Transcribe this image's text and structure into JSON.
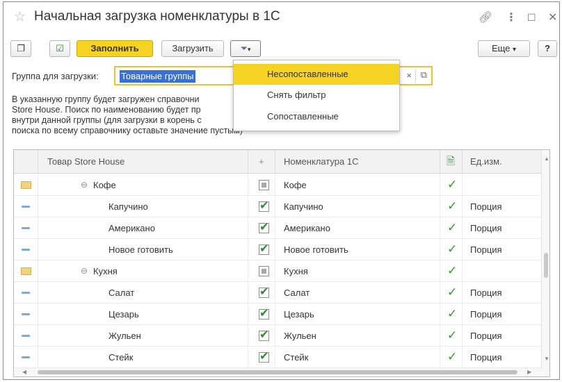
{
  "window": {
    "title": "Начальная загрузка номенклатуры в 1С"
  },
  "toolbar": {
    "fill_label": "Заполнить",
    "load_label": "Загрузить",
    "more_label": "Еще",
    "help_label": "?"
  },
  "group": {
    "label": "Группа для загрузки:",
    "value": "Товарные группы"
  },
  "note": {
    "line1": "В указанную группу будет загружен справочни",
    "line2": "Store House. Поиск по наименованию будет пр",
    "line3": "внутри данной группы (для загрузки в корень с",
    "line4": "поиска по всему справочнику оставьте значение пустым)"
  },
  "filter_menu": {
    "items": [
      {
        "label": "Несопоставленные",
        "active": true
      },
      {
        "label": "Снять фильтр",
        "active": false
      },
      {
        "label": "Сопоставленные",
        "active": false
      }
    ]
  },
  "table": {
    "headers": {
      "product": "Товар Store House",
      "plus": "+",
      "nomenclature": "Номенклатура 1С",
      "unit": "Ед.изм."
    },
    "rows": [
      {
        "type": "group",
        "name": "Кофе",
        "check": "indeterminate",
        "nomenclature": "Кофе",
        "matched": true,
        "unit": ""
      },
      {
        "type": "item",
        "name": "Капучино",
        "check": "checked",
        "nomenclature": "Капучино",
        "matched": true,
        "unit": "Порция"
      },
      {
        "type": "item",
        "name": "Американо",
        "check": "checked",
        "nomenclature": "Американо",
        "matched": true,
        "unit": "Порция"
      },
      {
        "type": "item",
        "name": "Новое готовить",
        "check": "checked",
        "nomenclature": "Новое готовить",
        "matched": true,
        "unit": "Порция"
      },
      {
        "type": "group",
        "name": "Кухня",
        "check": "indeterminate",
        "nomenclature": "Кухня",
        "matched": true,
        "unit": ""
      },
      {
        "type": "item",
        "name": "Салат",
        "check": "checked",
        "nomenclature": "Салат",
        "matched": true,
        "unit": "Порция"
      },
      {
        "type": "item",
        "name": "Цезарь",
        "check": "checked",
        "nomenclature": "Цезарь",
        "matched": true,
        "unit": "Порция"
      },
      {
        "type": "item",
        "name": "Жульен",
        "check": "checked",
        "nomenclature": "Жульен",
        "matched": true,
        "unit": "Порция"
      },
      {
        "type": "item",
        "name": "Стейк",
        "check": "checked",
        "nomenclature": "Стейк",
        "matched": true,
        "unit": "Порция"
      }
    ]
  },
  "colors": {
    "accent_yellow": "#f5d322",
    "selection_blue": "#3a6fd3",
    "check_green": "#2e9a2e"
  }
}
